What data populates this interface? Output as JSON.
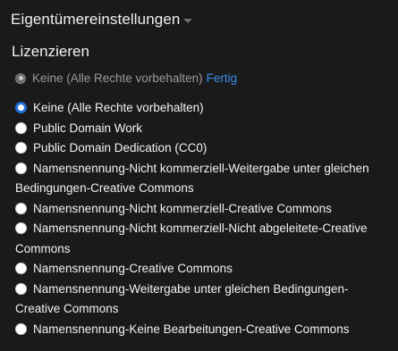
{
  "header": {
    "title": "Eigentümereinstellungen"
  },
  "license": {
    "section_title": "Lizenzieren",
    "current": {
      "label": "Keine (Alle Rechte vorbehalten)",
      "done_label": "Fertig"
    },
    "selected_index": 0,
    "options": [
      {
        "label": "Keine (Alle Rechte vorbehalten)"
      },
      {
        "label": "Public Domain Work"
      },
      {
        "label": "Public Domain Dedication (CC0)"
      },
      {
        "label": "Namensnennung-Nicht kommerziell-Weitergabe unter gleichen Bedingungen-Creative Commons"
      },
      {
        "label": "Namensnennung-Nicht kommerziell-Creative Commons"
      },
      {
        "label": "Namensnennung-Nicht kommerziell-Nicht abgeleitete-Creative Commons"
      },
      {
        "label": "Namensnennung-Creative Commons"
      },
      {
        "label": "Namensnennung-Weitergabe unter gleichen Bedingungen-Creative Commons"
      },
      {
        "label": "Namensnennung-Keine Bearbeitungen-Creative Commons"
      }
    ]
  },
  "colors": {
    "background": "#1a1a1a",
    "link": "#3b8ee6",
    "radio_checked": "#1f6fd6"
  }
}
